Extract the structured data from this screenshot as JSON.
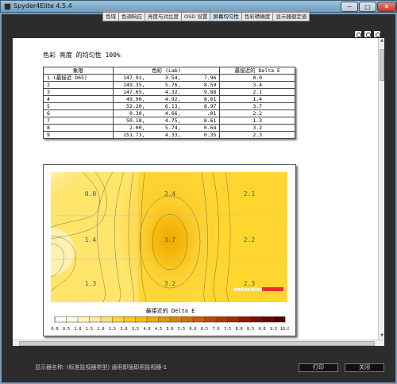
{
  "window": {
    "title": "Spyder4Elite 4.5.4",
    "minimize": "−",
    "maximize": "□",
    "close": "✕"
  },
  "tabs": [
    {
      "label": "色域",
      "active": false
    },
    {
      "label": "色调响应",
      "active": false
    },
    {
      "label": "亮度与对比度",
      "active": false
    },
    {
      "label": "OSD 设置",
      "active": false
    },
    {
      "label": "屏幕均匀性",
      "active": true
    },
    {
      "label": "色彩精确度",
      "active": false
    },
    {
      "label": "显示器额定值",
      "active": false
    }
  ],
  "zoom_icons": [
    "zoom-in-icon",
    "zoom-out-icon",
    "zoom-fit-icon"
  ],
  "report": {
    "title": "色彩 亮度 的均匀性 100%",
    "table": {
      "headers": [
        "象限",
        "色彩 (Lab)",
        "最接近的 Delta E"
      ],
      "rows": [
        {
          "zone": "1 (最接近 D65)",
          "L": "147.91,",
          "a": "3.54,",
          "b": "7.96",
          "de": "0.0"
        },
        {
          "zone": "2",
          "L": "149.35,",
          "a": "5.76,",
          "b": "8.59",
          "de": "3.4"
        },
        {
          "zone": "3",
          "L": "147.65,",
          "a": "4.32,",
          "b": "9.88",
          "de": "2.1"
        },
        {
          "zone": "4",
          "L": "49.90,",
          "a": "4.92,",
          "b": "8.61",
          "de": "1.4"
        },
        {
          "zone": "5",
          "L": "52.20,",
          "a": "6.13,",
          "b": "8.97",
          "de": "3.7"
        },
        {
          "zone": "6",
          "L": "0.30,",
          "a": "4.66,",
          "b": ".01",
          "de": "2.2"
        },
        {
          "zone": "7",
          "L": "50.18,",
          "a": "4.75,",
          "b": "8.61",
          "de": "1.3"
        },
        {
          "zone": "8",
          "L": "2.00,",
          "a": "5.74,",
          "b": "0.64",
          "de": "3.2"
        },
        {
          "zone": "9",
          "L": "151.73,",
          "a": "4.33,",
          "b": "0.35",
          "de": "2.3"
        }
      ]
    },
    "map_values": [
      "0.0",
      "3.4",
      "2.1",
      "1.4",
      "3.7",
      "2.2",
      "1.3",
      "3.2",
      "2.3"
    ],
    "brand": "datacolor",
    "brand_color": "#e8312b",
    "legend_title": "最接近的 Delta E",
    "scale_ticks": [
      "0.0",
      "0.5",
      "1.0",
      "1.5",
      "2.0",
      "2.5",
      "3.0",
      "3.5",
      "4.0",
      "4.5",
      "5.0",
      "5.5",
      "6.0",
      "6.5",
      "7.0",
      "7.5",
      "8.0",
      "8.5",
      "9.0",
      "9.5",
      "10.0"
    ],
    "scale_colors": [
      "#ffffff",
      "#fffbe6",
      "#fff4c2",
      "#ffec99",
      "#ffe26b",
      "#ffd63a",
      "#ffcb14",
      "#f9bd00",
      "#f0aa00",
      "#e89600",
      "#e08200",
      "#d76e00",
      "#ce5a00",
      "#c44700",
      "#b93500",
      "#ac2400",
      "#9a1500",
      "#840a00",
      "#6a0400",
      "#4a0000"
    ]
  },
  "status": {
    "text": "显示器名称: (标准监视器类型) 通用即插即用监视器-1"
  },
  "buttons": {
    "print": "打印",
    "close": "关闭"
  }
}
